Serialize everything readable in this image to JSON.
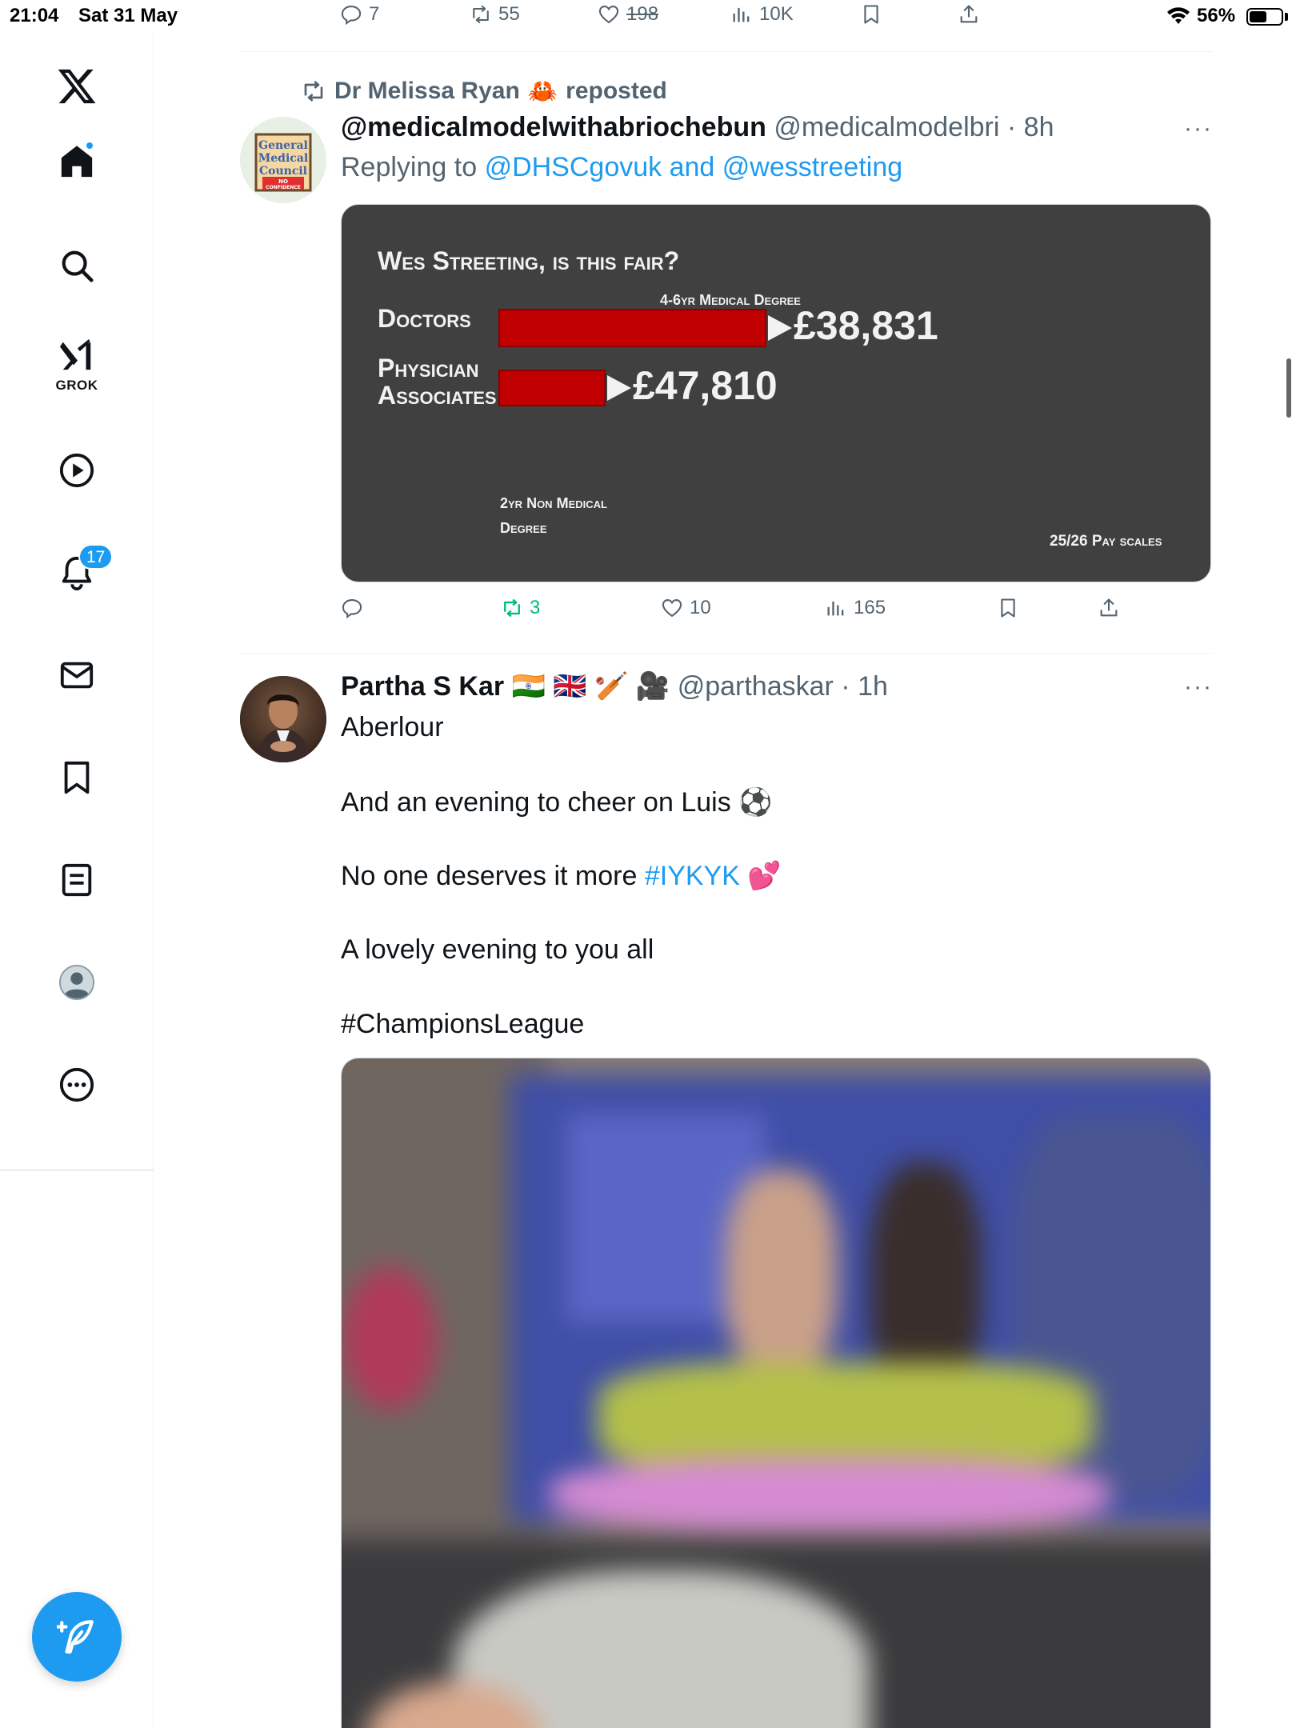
{
  "status_bar": {
    "time": "21:04",
    "date": "Sat 31 May",
    "battery": "56%",
    "battery_level": 0.56
  },
  "sidebar": {
    "logo": "x-logo-icon",
    "items": [
      {
        "name": "home",
        "icon": "home-icon",
        "active": true,
        "dot": true
      },
      {
        "name": "explore",
        "icon": "search-icon"
      },
      {
        "name": "grok",
        "icon": "grok-icon",
        "label": "GROK"
      },
      {
        "name": "videos",
        "icon": "play-icon"
      },
      {
        "name": "notifications",
        "icon": "bell-icon",
        "badge": "17"
      },
      {
        "name": "messages",
        "icon": "envelope-icon"
      },
      {
        "name": "bookmarks",
        "icon": "bookmark-icon"
      },
      {
        "name": "lists",
        "icon": "list-icon"
      },
      {
        "name": "profile",
        "icon": "profile-icon"
      },
      {
        "name": "more",
        "icon": "more-circle-icon"
      }
    ],
    "compose_icon": "compose-icon"
  },
  "prev_tweet": {
    "replies": "7",
    "reposts": "55",
    "likes": "198",
    "views": "10K"
  },
  "tweet1": {
    "reposted_by": "Dr Melissa Ryan",
    "reposted_emoji": "🦀",
    "reposted_label": "reposted",
    "name": "@medicalmodelwithabriochebun",
    "handle": "@medicalmodelbri",
    "time": "8h",
    "replying_prefix": "Replying to",
    "replying_to": "@DHSCgovuk and @wesstreeting",
    "avatar_text": [
      "General",
      "Medical",
      "Council",
      "NO",
      "CONFIDENCE"
    ],
    "chart_data": {
      "type": "bar",
      "title": "Wes Streeting, is this fair?",
      "categories": [
        "Doctors",
        "Physician Associates"
      ],
      "category_lines": [
        [
          "Doctors"
        ],
        [
          "Physician",
          "Associates"
        ]
      ],
      "values": [
        38831,
        47810
      ],
      "value_labels": [
        "£38,831",
        "£47,810"
      ],
      "bar_annotations": [
        "4-6yr Medical Degree",
        "2yr Non Medical Degree"
      ],
      "annotation_lines": [
        [
          "4-6yr Medical Degree"
        ],
        [
          "2yr Non Medical",
          "Degree"
        ]
      ],
      "footnote": "25/26 Pay scales",
      "bar_color": "#c00000",
      "background": "#404040",
      "note": "bar lengths represent degree years (4-6 vs 2), not salary"
    },
    "degree_years": [
      5,
      2
    ],
    "replies": "",
    "reposts": "3",
    "likes": "10",
    "views": "165"
  },
  "tweet2": {
    "name": "Partha S Kar",
    "name_emojis": "🇮🇳 🇬🇧 🏏 🎥",
    "handle": "@parthaskar",
    "time": "1h",
    "lines": {
      "l1": "Aberlour",
      "l2": "And an evening to cheer on Luis ⚽",
      "l3_prefix": "No one deserves it more ",
      "l3_hashtag": "#IYKYK",
      "l3_suffix": " 💕",
      "l4": "A lovely evening to you all",
      "l5_hashtag": "#ChampionsLeague"
    }
  },
  "colors": {
    "accent": "#1d9bf0",
    "text": "#0f1419",
    "muted": "#536471",
    "repost_green": "#00ba7c"
  }
}
